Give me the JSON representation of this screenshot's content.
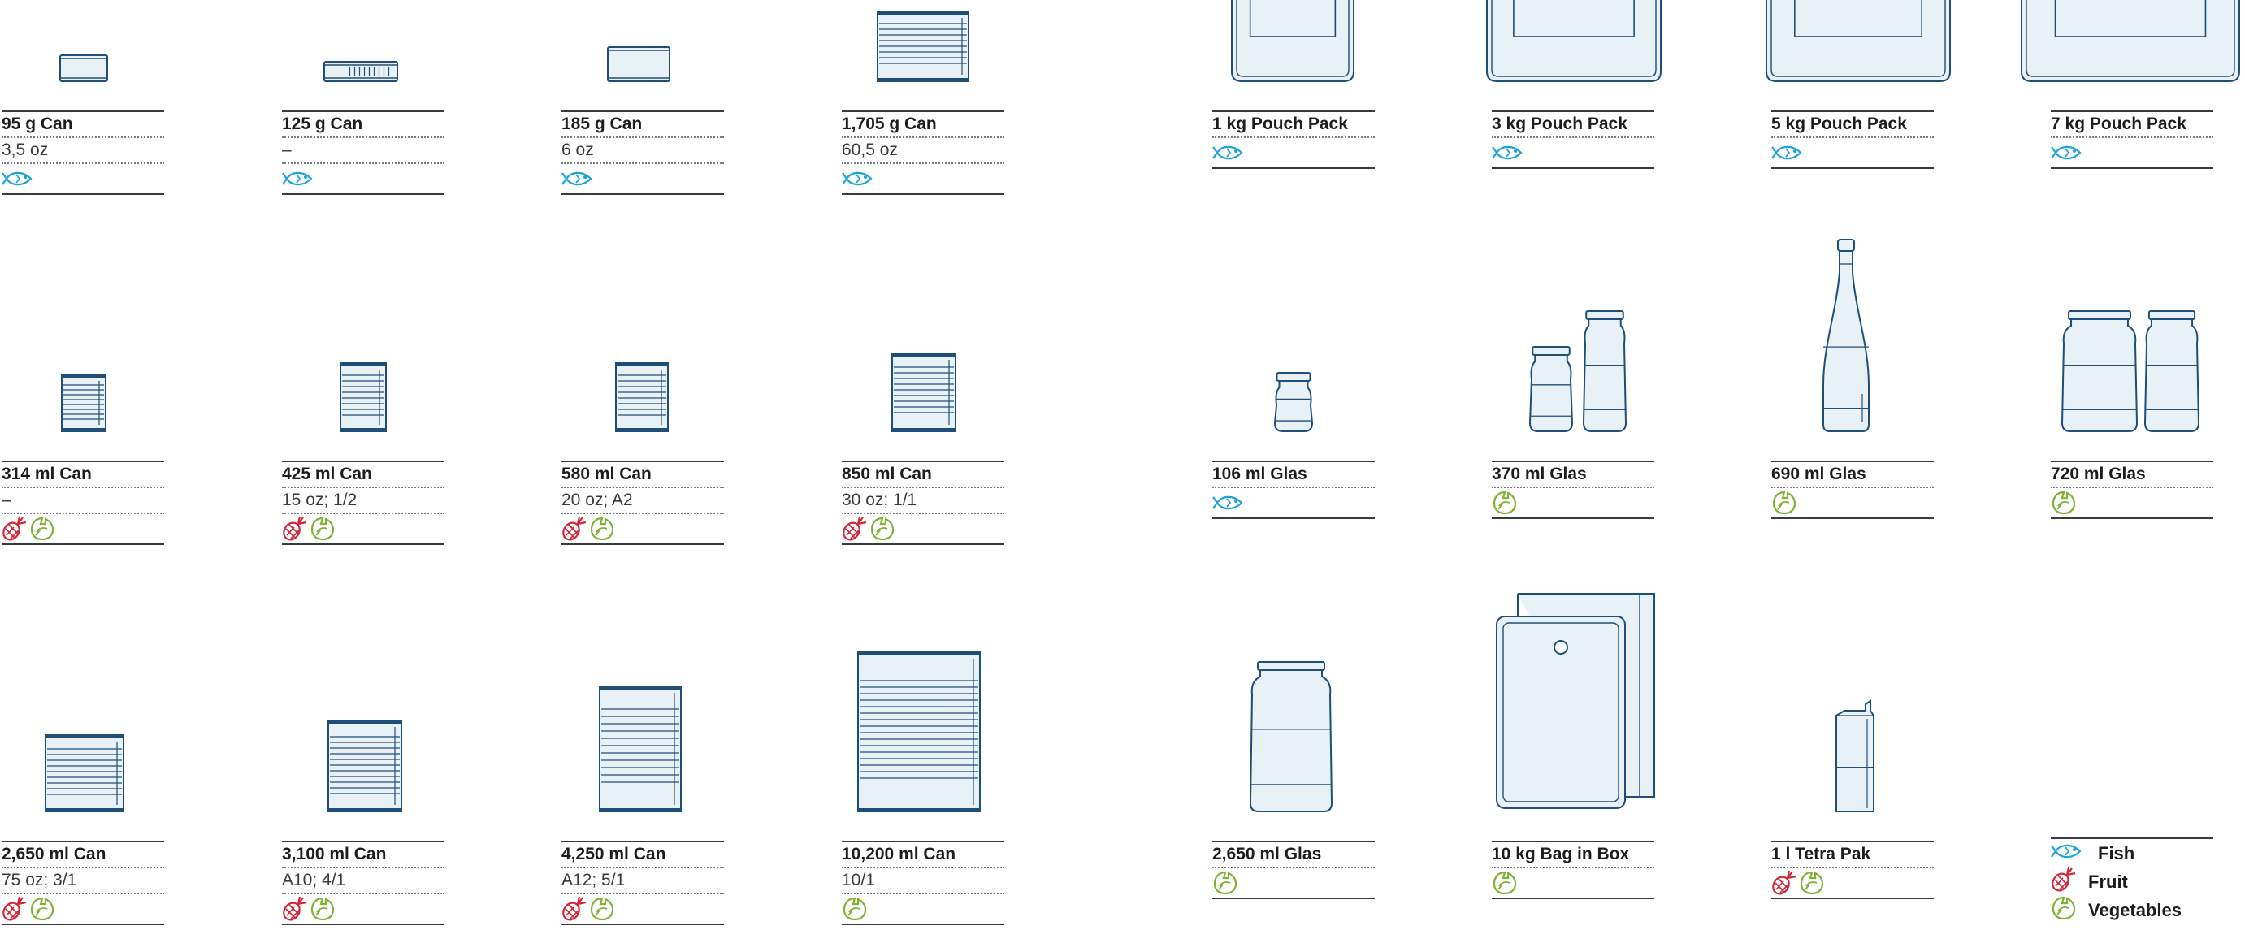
{
  "colors": {
    "line": "#1f4e79",
    "fill": "#e8f1f5",
    "fish": "#1aa4d8",
    "fruit": "#d0283a",
    "vegetables": "#7fb234"
  },
  "icon_names": {
    "fish": "fish-icon",
    "fruit": "pineapple-icon",
    "vegetables": "artichoke-icon"
  },
  "rows": [
    [
      {
        "title": "95 g Can",
        "sub": "3,5 oz",
        "icons": [
          "fish"
        ]
      },
      {
        "title": "125 g Can",
        "sub": "–",
        "icons": [
          "fish"
        ]
      },
      {
        "title": "185 g Can",
        "sub": "6 oz",
        "icons": [
          "fish"
        ]
      },
      {
        "title": "1,705 g Can",
        "sub": "60,5 oz",
        "icons": [
          "fish"
        ]
      },
      {
        "title": "1 kg Pouch Pack",
        "sub": null,
        "icons": [
          "fish"
        ]
      },
      {
        "title": "3 kg Pouch Pack",
        "sub": null,
        "icons": [
          "fish"
        ]
      },
      {
        "title": "5 kg Pouch Pack",
        "sub": null,
        "icons": [
          "fish"
        ]
      },
      {
        "title": "7 kg Pouch Pack",
        "sub": null,
        "icons": [
          "fish"
        ]
      }
    ],
    [
      {
        "title": "314 ml Can",
        "sub": "–",
        "icons": [
          "fruit",
          "vegetables"
        ]
      },
      {
        "title": "425 ml Can",
        "sub": "15 oz; 1/2",
        "icons": [
          "fruit",
          "vegetables"
        ]
      },
      {
        "title": "580 ml Can",
        "sub": "20 oz; A2",
        "icons": [
          "fruit",
          "vegetables"
        ]
      },
      {
        "title": "850 ml Can",
        "sub": "30 oz; 1/1",
        "icons": [
          "fruit",
          "vegetables"
        ]
      },
      {
        "title": "106 ml Glas",
        "sub": null,
        "icons": [
          "fish"
        ]
      },
      {
        "title": "370 ml Glas",
        "sub": null,
        "icons": [
          "vegetables"
        ]
      },
      {
        "title": "690 ml Glas",
        "sub": null,
        "icons": [
          "vegetables"
        ]
      },
      {
        "title": "720 ml Glas",
        "sub": null,
        "icons": [
          "vegetables"
        ]
      }
    ],
    [
      {
        "title": "2,650 ml Can",
        "sub": "75 oz; 3/1",
        "icons": [
          "fruit",
          "vegetables"
        ]
      },
      {
        "title": "3,100 ml Can",
        "sub": "A10; 4/1",
        "icons": [
          "fruit",
          "vegetables"
        ]
      },
      {
        "title": "4,250 ml Can",
        "sub": "A12; 5/1",
        "icons": [
          "fruit",
          "vegetables"
        ]
      },
      {
        "title": "10,200 ml Can",
        "sub": "10/1",
        "icons": [
          "vegetables"
        ]
      },
      {
        "title": "2,650 ml Glas",
        "sub": null,
        "icons": [
          "vegetables"
        ]
      },
      {
        "title": "10 kg Bag in Box",
        "sub": null,
        "icons": [
          "vegetables"
        ]
      },
      {
        "title": "1 l  Tetra Pak",
        "sub": null,
        "icons": [
          "fruit",
          "vegetables"
        ]
      }
    ]
  ],
  "legend": [
    {
      "key": "fish",
      "label": "Fish"
    },
    {
      "key": "fruit",
      "label": "Fruit"
    },
    {
      "key": "vegetables",
      "label": "Vegetables"
    }
  ]
}
